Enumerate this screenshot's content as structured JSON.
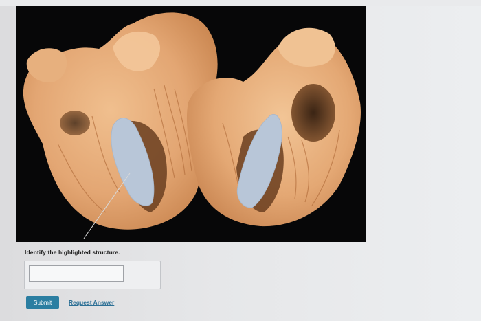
{
  "question": {
    "prompt": "Identify the highlighted structure."
  },
  "answer": {
    "value": "",
    "placeholder": ""
  },
  "actions": {
    "submit_label": "Submit",
    "request_answer_label": "Request Answer"
  },
  "image": {
    "subject": "dissected heart specimen with highlighted structure",
    "highlight_color": "#b8c6d8",
    "tissue_color": "#e2a878",
    "background_color": "#070708"
  },
  "colors": {
    "submit_button": "#2b7ea1",
    "link": "#2b6f95"
  }
}
